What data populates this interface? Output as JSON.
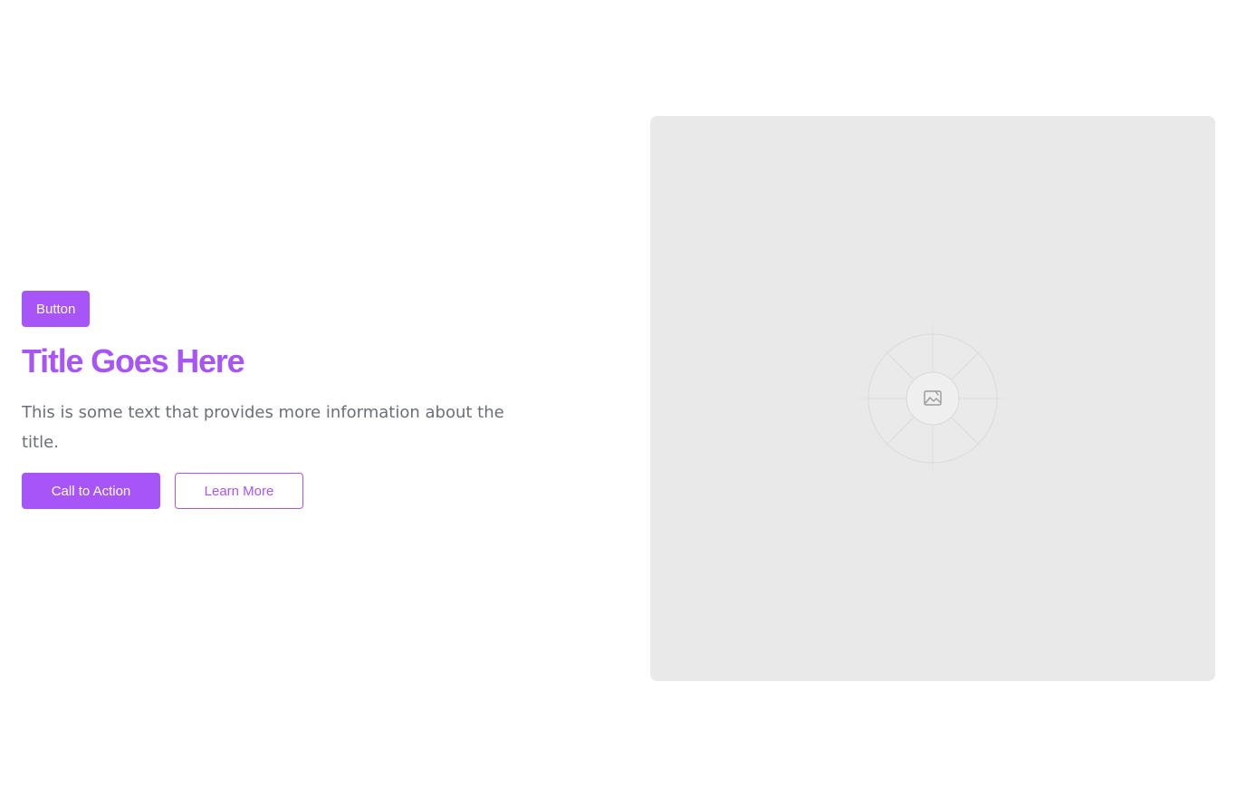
{
  "hero": {
    "badge_label": "Button",
    "title": "Title Goes Here",
    "description": "This is some text that provides more information about the title.",
    "primary_cta_label": "Call to Action",
    "secondary_cta_label": "Learn More"
  },
  "media": {
    "icon": "image-icon"
  },
  "colors": {
    "accent": "#a855f7",
    "body_text": "#6b6f78",
    "placeholder_bg": "#e9e9e9"
  }
}
